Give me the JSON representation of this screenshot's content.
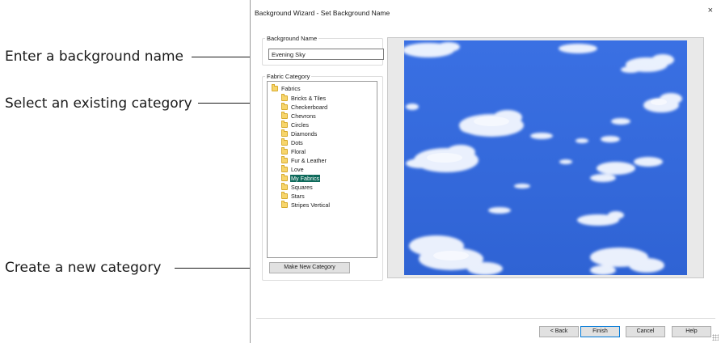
{
  "callouts": {
    "name": "Enter a background name",
    "category": "Select an existing category",
    "new_category": "Create a new category"
  },
  "dialog": {
    "title": "Background Wizard - Set Background Name",
    "close_glyph": "×",
    "background_name": {
      "legend": "Background Name",
      "value": "Evening Sky"
    },
    "fabric_category": {
      "legend": "Fabric Category",
      "root": "Fabrics",
      "items": [
        {
          "label": "Bricks & Tiles"
        },
        {
          "label": "Checkerboard"
        },
        {
          "label": "Chevrons"
        },
        {
          "label": "Circles"
        },
        {
          "label": "Diamonds"
        },
        {
          "label": "Dots"
        },
        {
          "label": "Floral"
        },
        {
          "label": "Fur & Leather"
        },
        {
          "label": "Love"
        },
        {
          "label": "My Fabrics"
        },
        {
          "label": "Squares"
        },
        {
          "label": "Stars"
        },
        {
          "label": "Stripes Vertical"
        }
      ],
      "selected": "My Fabrics",
      "make_new_button": "Make New Category"
    },
    "buttons": {
      "back": "< Back",
      "finish": "Finish",
      "cancel": "Cancel",
      "help": "Help"
    }
  },
  "colors": {
    "sky": "#3b6fe0",
    "selection": "#0e6a5b",
    "folder": "#f7d56b"
  }
}
